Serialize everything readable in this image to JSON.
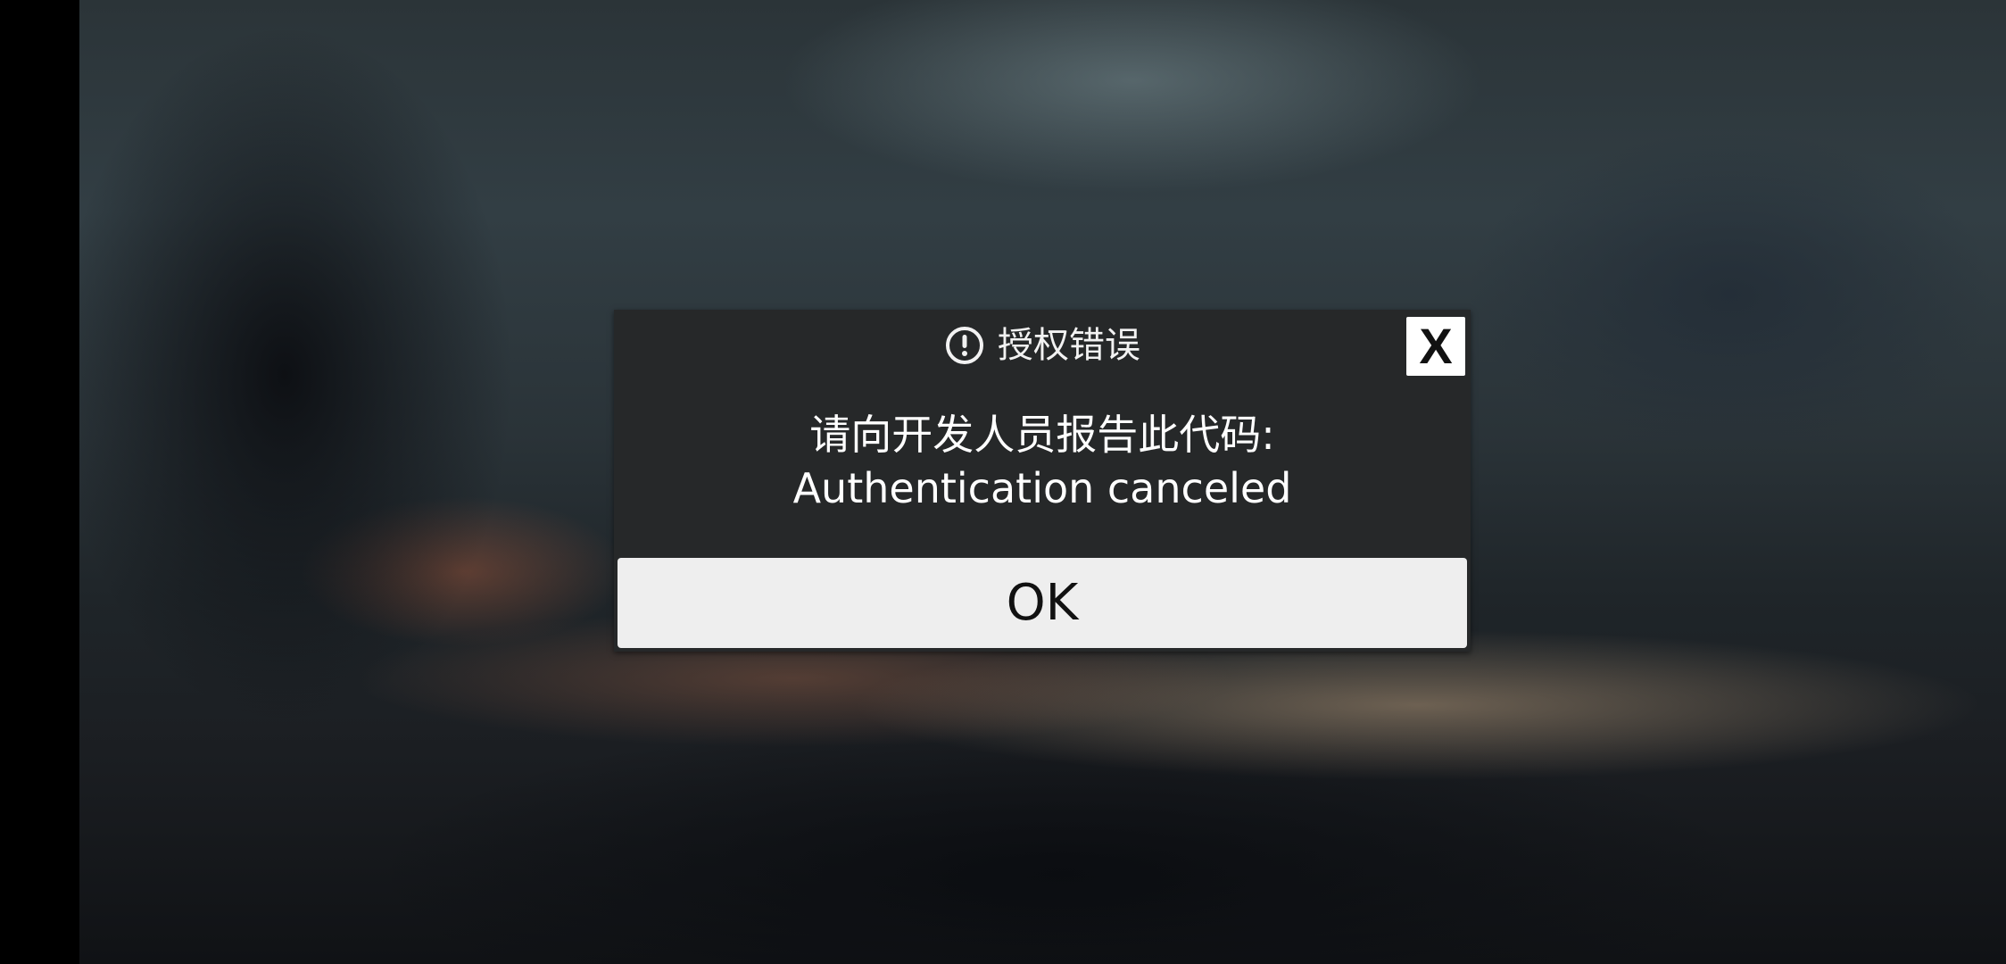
{
  "dialog": {
    "title": "授权错误",
    "title_icon": "alert-circle-icon",
    "close_label": "X",
    "message_line1": "请向开发人员报告此代码:",
    "message_line2": "Authentication canceled",
    "ok_label": "OK"
  },
  "colors": {
    "dialog_background": "#262829",
    "button_background": "#eeeeee",
    "text_light": "#ffffff",
    "text_dark": "#111111"
  }
}
